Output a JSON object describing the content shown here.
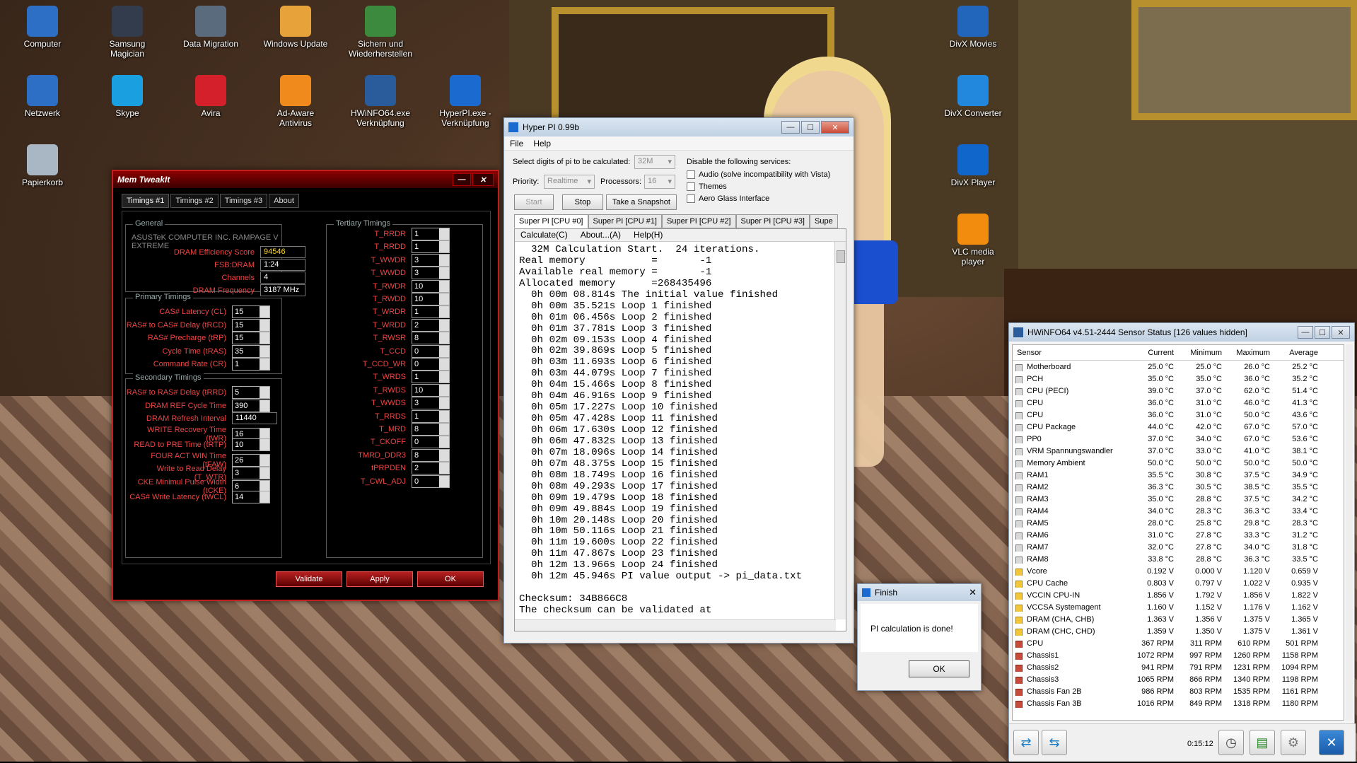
{
  "desktop": {
    "icons": [
      {
        "label": "Computer",
        "color": "#2d6fc4"
      },
      {
        "label": "Samsung Magician",
        "color": "#333c4d"
      },
      {
        "label": "Data Migration",
        "color": "#5a6b7d"
      },
      {
        "label": "Windows Update",
        "color": "#e7a23a"
      },
      {
        "label": "Sichern und Wiederherstellen",
        "color": "#3b8a3e"
      },
      {
        "label": "Netzwerk",
        "color": "#2d6fc4"
      },
      {
        "label": "Skype",
        "color": "#1aa0e0"
      },
      {
        "label": "Avira",
        "color": "#d4202a"
      },
      {
        "label": "Ad-Aware Antivirus",
        "color": "#f08a1c"
      },
      {
        "label": "HWiNFO64.exe Verknüpfung",
        "color": "#2a5c9c"
      },
      {
        "label": "HyperPI.exe - Verknüpfung",
        "color": "#1a6ad0"
      },
      {
        "label": "Papierkorb",
        "color": "#a9b6c4"
      },
      {
        "label": "DivX Movies",
        "color": "#2266bb"
      },
      {
        "label": "DivX Converter",
        "color": "#2288dd"
      },
      {
        "label": "DivX Player",
        "color": "#1166cc"
      },
      {
        "label": "VLC media player",
        "color": "#f28c0f"
      }
    ]
  },
  "memtweak": {
    "title": "Mem TweakIt",
    "tabs": [
      "Timings #1",
      "Timings #2",
      "Timings #3",
      "About"
    ],
    "general": {
      "label": "General",
      "board": "ASUSTeK COMPUTER INC. RAMPAGE V EXTREME",
      "fields": [
        {
          "label": "DRAM Efficiency Score",
          "value": "94546"
        },
        {
          "label": "FSB:DRAM",
          "value": "1:24"
        },
        {
          "label": "Channels",
          "value": "4"
        },
        {
          "label": "DRAM Frequency",
          "value": "3187 MHz"
        }
      ]
    },
    "primary": {
      "label": "Primary Timings",
      "fields": [
        {
          "label": "CAS# Latency (CL)",
          "value": "15"
        },
        {
          "label": "RAS# to CAS# Delay (tRCD)",
          "value": "15"
        },
        {
          "label": "RAS# Precharge (tRP)",
          "value": "15"
        },
        {
          "label": "Cycle Time (tRAS)",
          "value": "35"
        },
        {
          "label": "Command Rate (CR)",
          "value": "1"
        }
      ]
    },
    "secondary": {
      "label": "Secondary Timings",
      "fields": [
        {
          "label": "RAS# to RAS# Delay (tRRD)",
          "value": "5"
        },
        {
          "label": "DRAM REF Cycle Time",
          "value": "390"
        },
        {
          "label": "DRAM Refresh Interval",
          "value": "11440"
        },
        {
          "label": "WRITE Recovery Time (tWR)",
          "value": "16"
        },
        {
          "label": "READ to PRE Time (tRTP)",
          "value": "10"
        },
        {
          "label": "FOUR ACT WIN Time (tFAW)",
          "value": "26"
        },
        {
          "label": "Write to Read Delay (T_WTR)",
          "value": "3"
        },
        {
          "label": "CKE Minimul Pulse Width (tCKE)",
          "value": "6"
        },
        {
          "label": "CAS# Write Latency (tWCL)",
          "value": "14"
        }
      ]
    },
    "tertiary": {
      "label": "Tertiary Timings",
      "fields": [
        {
          "label": "T_RRDR",
          "value": "1"
        },
        {
          "label": "T_RRDD",
          "value": "1"
        },
        {
          "label": "T_WWDR",
          "value": "3"
        },
        {
          "label": "T_WWDD",
          "value": "3"
        },
        {
          "label": "T_RWDR",
          "value": "10"
        },
        {
          "label": "T_RWDD",
          "value": "10"
        },
        {
          "label": "T_WRDR",
          "value": "1"
        },
        {
          "label": "T_WRDD",
          "value": "2"
        },
        {
          "label": "T_RWSR",
          "value": "8"
        },
        {
          "label": "T_CCD",
          "value": "0"
        },
        {
          "label": "T_CCD_WR",
          "value": "0"
        },
        {
          "label": "T_WRDS",
          "value": "1"
        },
        {
          "label": "T_RWDS",
          "value": "10"
        },
        {
          "label": "T_WWDS",
          "value": "3"
        },
        {
          "label": "T_RRDS",
          "value": "1"
        },
        {
          "label": "T_MRD",
          "value": "8"
        },
        {
          "label": "T_CKOFF",
          "value": "0"
        },
        {
          "label": "TMRD_DDR3",
          "value": "8"
        },
        {
          "label": "tPRPDEN",
          "value": "2"
        },
        {
          "label": "T_CWL_ADJ",
          "value": "0"
        }
      ]
    },
    "buttons": {
      "validate": "Validate",
      "apply": "Apply",
      "ok": "OK"
    }
  },
  "hyperpi": {
    "title": "Hyper PI 0.99b",
    "menu": [
      "File",
      "Help"
    ],
    "digits_label": "Select digits of pi to be calculated:",
    "digits_value": "32M",
    "priority_label": "Priority:",
    "priority_value": "Realtime",
    "processors_label": "Processors:",
    "processors_value": "16",
    "services_label": "Disable the following services:",
    "services": [
      "Audio (solve incompatibility with Vista)",
      "Themes",
      "Aero Glass Interface"
    ],
    "buttons": {
      "start": "Start",
      "stop": "Stop",
      "snapshot": "Take a Snapshot"
    },
    "tabs": [
      "Super PI [CPU #0]",
      "Super PI [CPU #1]",
      "Super PI [CPU #2]",
      "Super PI [CPU #3]",
      "Supe"
    ],
    "inner_menu": [
      "Calculate(C)",
      "About...(A)",
      "Help(H)"
    ],
    "log": [
      "  32M Calculation Start.  24 iterations.",
      "Real memory           =       -1",
      "Available real memory =       -1",
      "Allocated memory      =268435496",
      "  0h 00m 08.814s The initial value finished",
      "  0h 00m 35.521s Loop 1 finished",
      "  0h 01m 06.456s Loop 2 finished",
      "  0h 01m 37.781s Loop 3 finished",
      "  0h 02m 09.153s Loop 4 finished",
      "  0h 02m 39.869s Loop 5 finished",
      "  0h 03m 11.693s Loop 6 finished",
      "  0h 03m 44.079s Loop 7 finished",
      "  0h 04m 15.466s Loop 8 finished",
      "  0h 04m 46.916s Loop 9 finished",
      "  0h 05m 17.227s Loop 10 finished",
      "  0h 05m 47.428s Loop 11 finished",
      "  0h 06m 17.630s Loop 12 finished",
      "  0h 06m 47.832s Loop 13 finished",
      "  0h 07m 18.096s Loop 14 finished",
      "  0h 07m 48.375s Loop 15 finished",
      "  0h 08m 18.749s Loop 16 finished",
      "  0h 08m 49.293s Loop 17 finished",
      "  0h 09m 19.479s Loop 18 finished",
      "  0h 09m 49.884s Loop 19 finished",
      "  0h 10m 20.148s Loop 20 finished",
      "  0h 10m 50.116s Loop 21 finished",
      "  0h 11m 19.600s Loop 22 finished",
      "  0h 11m 47.867s Loop 23 finished",
      "  0h 12m 13.966s Loop 24 finished",
      "  0h 12m 45.946s PI value output -> pi_data.txt",
      "",
      "Checksum: 34B866C8",
      "The checksum can be validated at"
    ]
  },
  "finish": {
    "title": "Finish",
    "message": "PI calculation is done!",
    "ok": "OK"
  },
  "hwinfo": {
    "title": "HWiNFO64 v4.51-2444 Sensor Status [126 values hidden]",
    "columns": [
      "Sensor",
      "Current",
      "Minimum",
      "Maximum",
      "Average"
    ],
    "rows": [
      {
        "icon": "temp",
        "name": "Motherboard",
        "cur": "25.0 °C",
        "min": "25.0 °C",
        "max": "26.0 °C",
        "avg": "25.2 °C"
      },
      {
        "icon": "temp",
        "name": "PCH",
        "cur": "35.0 °C",
        "min": "35.0 °C",
        "max": "36.0 °C",
        "avg": "35.2 °C"
      },
      {
        "icon": "temp",
        "name": "CPU (PECI)",
        "cur": "39.0 °C",
        "min": "37.0 °C",
        "max": "62.0 °C",
        "avg": "51.4 °C"
      },
      {
        "icon": "temp",
        "name": "CPU",
        "cur": "36.0 °C",
        "min": "31.0 °C",
        "max": "46.0 °C",
        "avg": "41.3 °C"
      },
      {
        "icon": "temp",
        "name": "CPU",
        "cur": "36.0 °C",
        "min": "31.0 °C",
        "max": "50.0 °C",
        "avg": "43.6 °C"
      },
      {
        "icon": "temp",
        "name": "CPU Package",
        "cur": "44.0 °C",
        "min": "42.0 °C",
        "max": "67.0 °C",
        "avg": "57.0 °C"
      },
      {
        "icon": "temp",
        "name": "PP0",
        "cur": "37.0 °C",
        "min": "34.0 °C",
        "max": "67.0 °C",
        "avg": "53.6 °C"
      },
      {
        "icon": "temp",
        "name": "VRM Spannungswandler",
        "cur": "37.0 °C",
        "min": "33.0 °C",
        "max": "41.0 °C",
        "avg": "38.1 °C"
      },
      {
        "icon": "temp",
        "name": "Memory Ambient",
        "cur": "50.0 °C",
        "min": "50.0 °C",
        "max": "50.0 °C",
        "avg": "50.0 °C"
      },
      {
        "icon": "temp",
        "name": "RAM1",
        "cur": "35.5 °C",
        "min": "30.8 °C",
        "max": "37.5 °C",
        "avg": "34.9 °C"
      },
      {
        "icon": "temp",
        "name": "RAM2",
        "cur": "36.3 °C",
        "min": "30.5 °C",
        "max": "38.5 °C",
        "avg": "35.5 °C"
      },
      {
        "icon": "temp",
        "name": "RAM3",
        "cur": "35.0 °C",
        "min": "28.8 °C",
        "max": "37.5 °C",
        "avg": "34.2 °C"
      },
      {
        "icon": "temp",
        "name": "RAM4",
        "cur": "34.0 °C",
        "min": "28.3 °C",
        "max": "36.3 °C",
        "avg": "33.4 °C"
      },
      {
        "icon": "temp",
        "name": "RAM5",
        "cur": "28.0 °C",
        "min": "25.8 °C",
        "max": "29.8 °C",
        "avg": "28.3 °C"
      },
      {
        "icon": "temp",
        "name": "RAM6",
        "cur": "31.0 °C",
        "min": "27.8 °C",
        "max": "33.3 °C",
        "avg": "31.2 °C"
      },
      {
        "icon": "temp",
        "name": "RAM7",
        "cur": "32.0 °C",
        "min": "27.8 °C",
        "max": "34.0 °C",
        "avg": "31.8 °C"
      },
      {
        "icon": "temp",
        "name": "RAM8",
        "cur": "33.8 °C",
        "min": "28.8 °C",
        "max": "36.3 °C",
        "avg": "33.5 °C"
      },
      {
        "icon": "volt",
        "name": "Vcore",
        "cur": "0.192 V",
        "min": "0.000 V",
        "max": "1.120 V",
        "avg": "0.659 V"
      },
      {
        "icon": "volt",
        "name": "CPU Cache",
        "cur": "0.803 V",
        "min": "0.797 V",
        "max": "1.022 V",
        "avg": "0.935 V"
      },
      {
        "icon": "volt",
        "name": "VCCIN CPU-IN",
        "cur": "1.856 V",
        "min": "1.792 V",
        "max": "1.856 V",
        "avg": "1.822 V"
      },
      {
        "icon": "volt",
        "name": "VCCSA Systemagent",
        "cur": "1.160 V",
        "min": "1.152 V",
        "max": "1.176 V",
        "avg": "1.162 V"
      },
      {
        "icon": "volt",
        "name": "DRAM (CHA, CHB)",
        "cur": "1.363 V",
        "min": "1.356 V",
        "max": "1.375 V",
        "avg": "1.365 V"
      },
      {
        "icon": "volt",
        "name": "DRAM (CHC, CHD)",
        "cur": "1.359 V",
        "min": "1.350 V",
        "max": "1.375 V",
        "avg": "1.361 V"
      },
      {
        "icon": "fan",
        "name": "CPU",
        "cur": "367 RPM",
        "min": "311 RPM",
        "max": "610 RPM",
        "avg": "501 RPM"
      },
      {
        "icon": "fan",
        "name": "Chassis1",
        "cur": "1072 RPM",
        "min": "997 RPM",
        "max": "1260 RPM",
        "avg": "1158 RPM"
      },
      {
        "icon": "fan",
        "name": "Chassis2",
        "cur": "941 RPM",
        "min": "791 RPM",
        "max": "1231 RPM",
        "avg": "1094 RPM"
      },
      {
        "icon": "fan",
        "name": "Chassis3",
        "cur": "1065 RPM",
        "min": "866 RPM",
        "max": "1340 RPM",
        "avg": "1198 RPM"
      },
      {
        "icon": "fan",
        "name": "Chassis Fan 2B",
        "cur": "986 RPM",
        "min": "803 RPM",
        "max": "1535 RPM",
        "avg": "1161 RPM"
      },
      {
        "icon": "fan",
        "name": "Chassis Fan 3B",
        "cur": "1016 RPM",
        "min": "849 RPM",
        "max": "1318 RPM",
        "avg": "1180 RPM"
      }
    ],
    "elapsed": "0:15:12"
  }
}
